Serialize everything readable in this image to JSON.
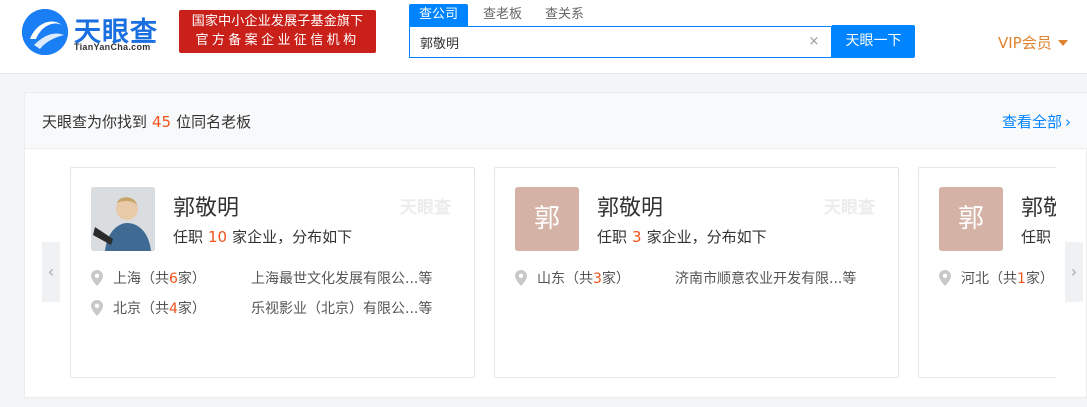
{
  "header": {
    "logo_text": "天眼查",
    "logo_sub": "TianYanCha.com",
    "banner_line1": "国家中小企业发展子基金旗下",
    "banner_line2": "官方备案企业征信机构",
    "search_tabs": [
      "查公司",
      "查老板",
      "查关系"
    ],
    "search_value": "郭敬明",
    "search_button": "天眼一下",
    "vip_label": "VIP会员"
  },
  "result": {
    "prefix": "天眼查为你找到",
    "count": "45",
    "suffix": "位同名老板",
    "view_all": "查看全部"
  },
  "cards": [
    {
      "avatar_letter": "",
      "name": "郭敬明",
      "watermark": "天眼查",
      "role_prefix": "任职",
      "role_count": "10",
      "role_suffix": "家企业，分布如下",
      "regions": [
        {
          "place": "上海",
          "open": "（共",
          "count": "6",
          "close": "家）",
          "company": "上海最世文化发展有限公...等"
        },
        {
          "place": "北京",
          "open": "（共",
          "count": "4",
          "close": "家）",
          "company": "乐视影业（北京）有限公...等"
        }
      ]
    },
    {
      "avatar_letter": "郭",
      "name": "郭敬明",
      "watermark": "天眼查",
      "role_prefix": "任职",
      "role_count": "3",
      "role_suffix": "家企业，分布如下",
      "regions": [
        {
          "place": "山东",
          "open": "（共",
          "count": "3",
          "close": "家）",
          "company": "济南市顺意农业开发有限...等"
        }
      ]
    },
    {
      "avatar_letter": "郭",
      "name": "郭敬",
      "role_prefix": "任职",
      "regions": [
        {
          "place": "河北",
          "open": "（共",
          "count": "1",
          "close": "家）"
        }
      ]
    }
  ],
  "icons": {
    "clear": "×",
    "prev": "‹",
    "next": "›",
    "view_all_chevron": "›"
  },
  "colors": {
    "brand_blue": "#0084ff",
    "banner_red": "#c9201a",
    "count_orange": "#f0531c",
    "vip_orange": "#e0832f",
    "avatar_tan": "#d4b2a5"
  }
}
